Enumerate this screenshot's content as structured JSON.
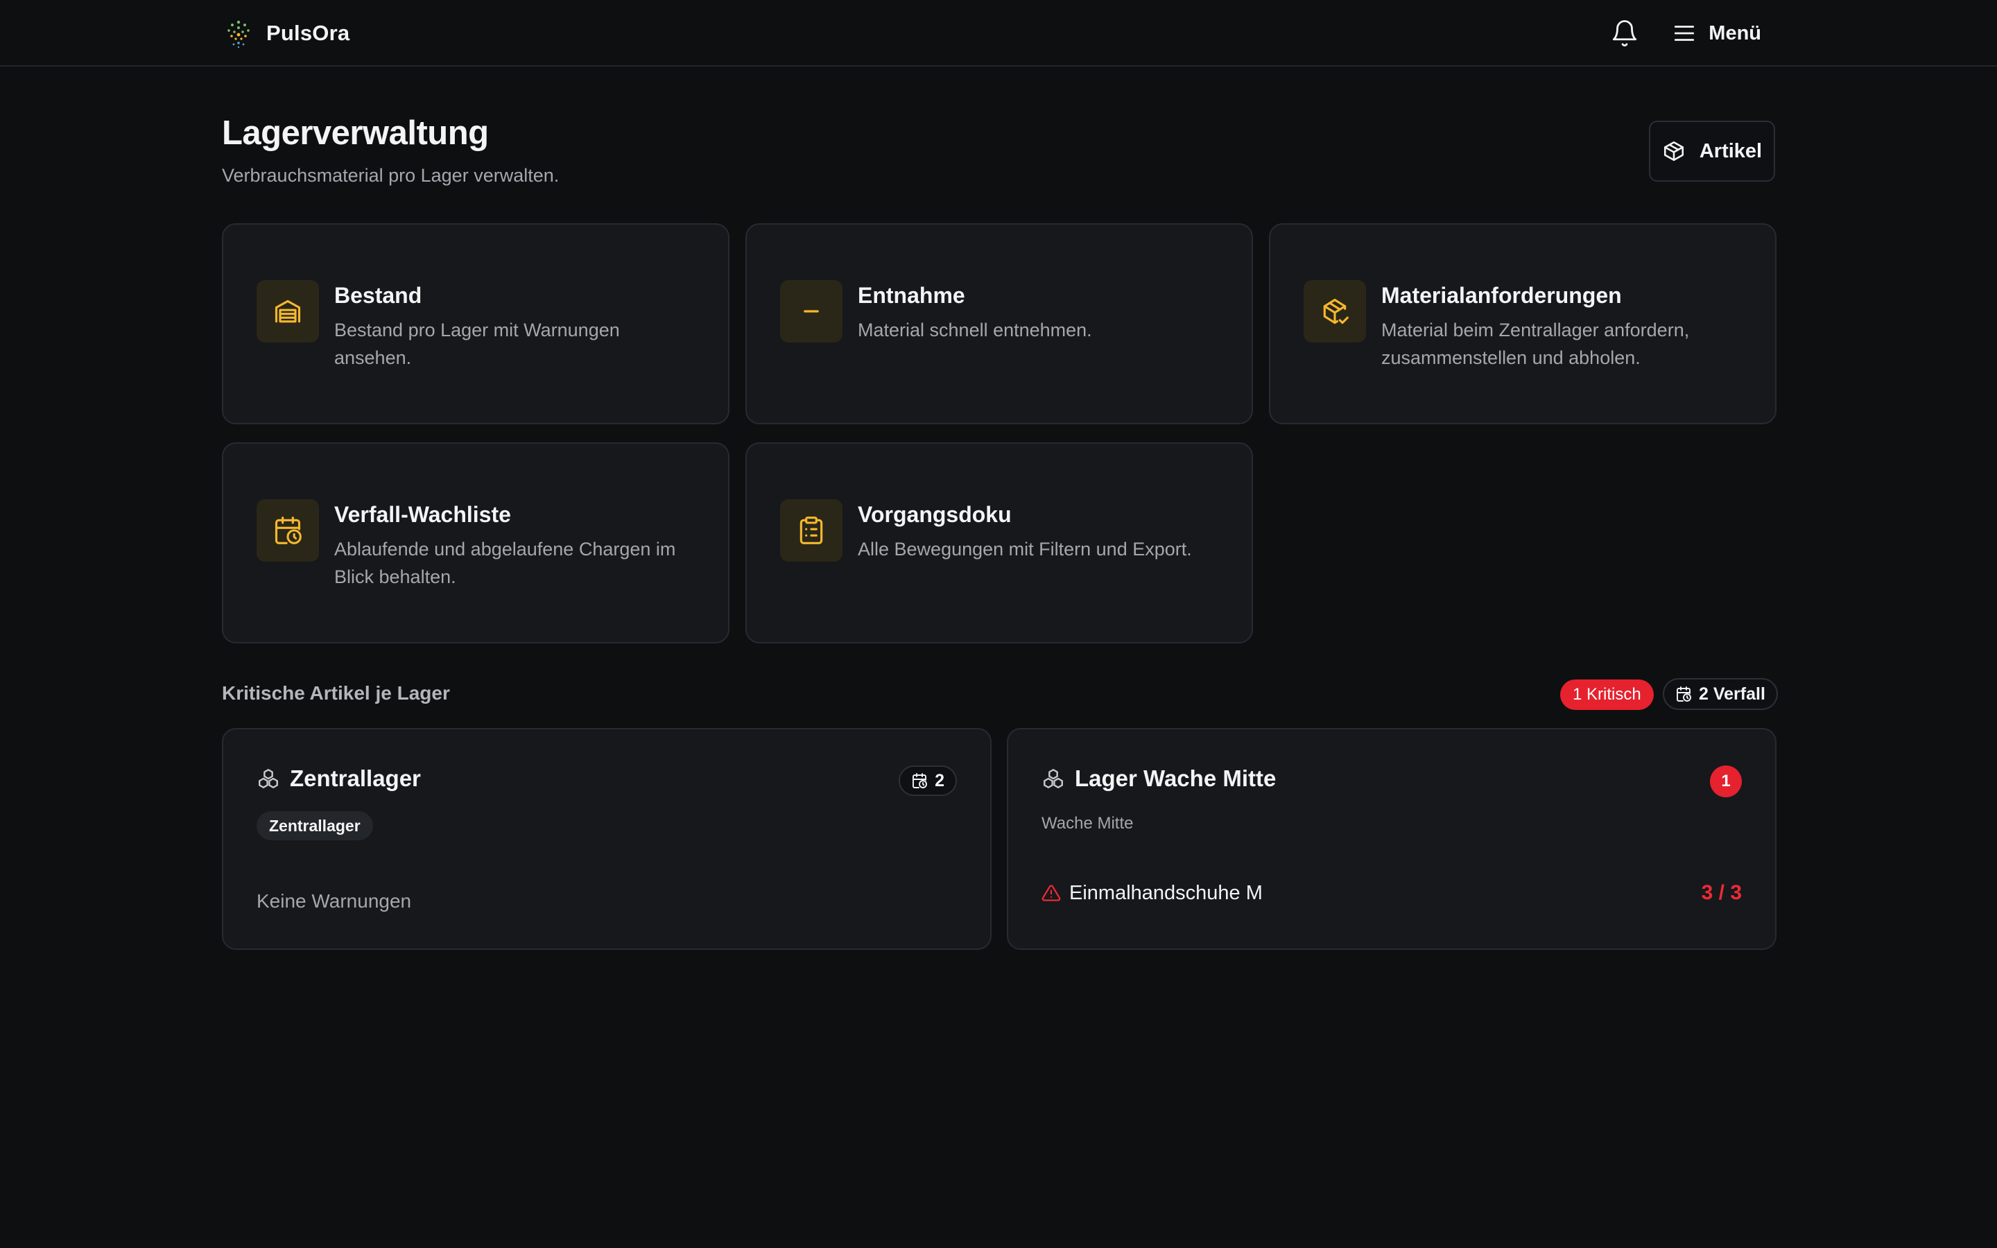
{
  "app": {
    "name": "PulsOra"
  },
  "topbar": {
    "menu_label": "Menü"
  },
  "page": {
    "title": "Lagerverwaltung",
    "subtitle": "Verbrauchsmaterial pro Lager verwalten.",
    "articles_button": "Artikel"
  },
  "features": [
    {
      "title": "Bestand",
      "desc": "Bestand pro Lager mit Warnungen ansehen.",
      "icon": "warehouse-icon"
    },
    {
      "title": "Entnahme",
      "desc": "Material schnell entnehmen.",
      "icon": "minus-icon"
    },
    {
      "title": "Materialanforderungen",
      "desc": "Material beim Zentrallager anfordern, zusammenstellen und abholen.",
      "icon": "package-check-icon"
    },
    {
      "title": "Verfall-Wachliste",
      "desc": "Ablaufende und abgelaufene Chargen im Blick behalten.",
      "icon": "calendar-clock-icon"
    },
    {
      "title": "Vorgangsdoku",
      "desc": "Alle Bewegungen mit Filtern und Export.",
      "icon": "clipboard-list-icon"
    }
  ],
  "critical": {
    "title": "Kritische Artikel je Lager",
    "critical_badge": "1 Kritisch",
    "expiry_badge": "2 Verfall",
    "locations": [
      {
        "name": "Zentrallager",
        "tag": "Zentrallager",
        "expiry_count": "2",
        "empty_text": "Keine Warnungen"
      },
      {
        "name": "Lager Wache Mitte",
        "sublabel": "Wache Mitte",
        "critical_count": "1",
        "items": [
          {
            "name": "Einmalhandschuhe M",
            "qty": "3 / 3"
          }
        ]
      }
    ]
  },
  "colors": {
    "accent": "#f5b82e",
    "critical": "#e5222e",
    "background": "#0e0f11",
    "card": "#16181c"
  }
}
